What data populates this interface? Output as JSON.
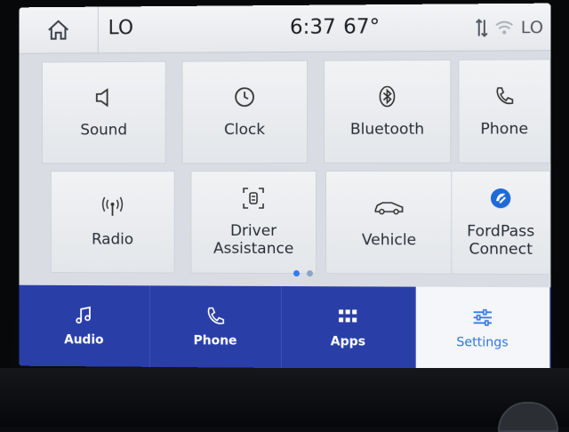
{
  "status_bar": {
    "driver_temp": "LO",
    "time": "6:37",
    "outside_temp": "67°",
    "passenger_temp": "LO"
  },
  "tiles": [
    {
      "label": "Sound",
      "icon": "speaker-icon"
    },
    {
      "label": "Clock",
      "icon": "clock-icon"
    },
    {
      "label": "Bluetooth",
      "icon": "bluetooth-icon"
    },
    {
      "label": "Phone",
      "icon": "phone-icon"
    },
    {
      "label": "Radio",
      "icon": "radio-antenna-icon"
    },
    {
      "label": "Driver\nAssistance",
      "icon": "driver-assist-icon"
    },
    {
      "label": "Vehicle",
      "icon": "car-icon"
    },
    {
      "label": "FordPass\nConnect",
      "icon": "fordpass-icon"
    }
  ],
  "page_indicator": {
    "current": 1,
    "total": 2
  },
  "nav": {
    "audio": "Audio",
    "phone": "Phone",
    "apps": "Apps",
    "settings": "Settings",
    "active": "settings"
  },
  "colors": {
    "nav_bg": "#2a3ea8",
    "accent": "#2f74e0",
    "screen_bg": "#d9dde3"
  }
}
